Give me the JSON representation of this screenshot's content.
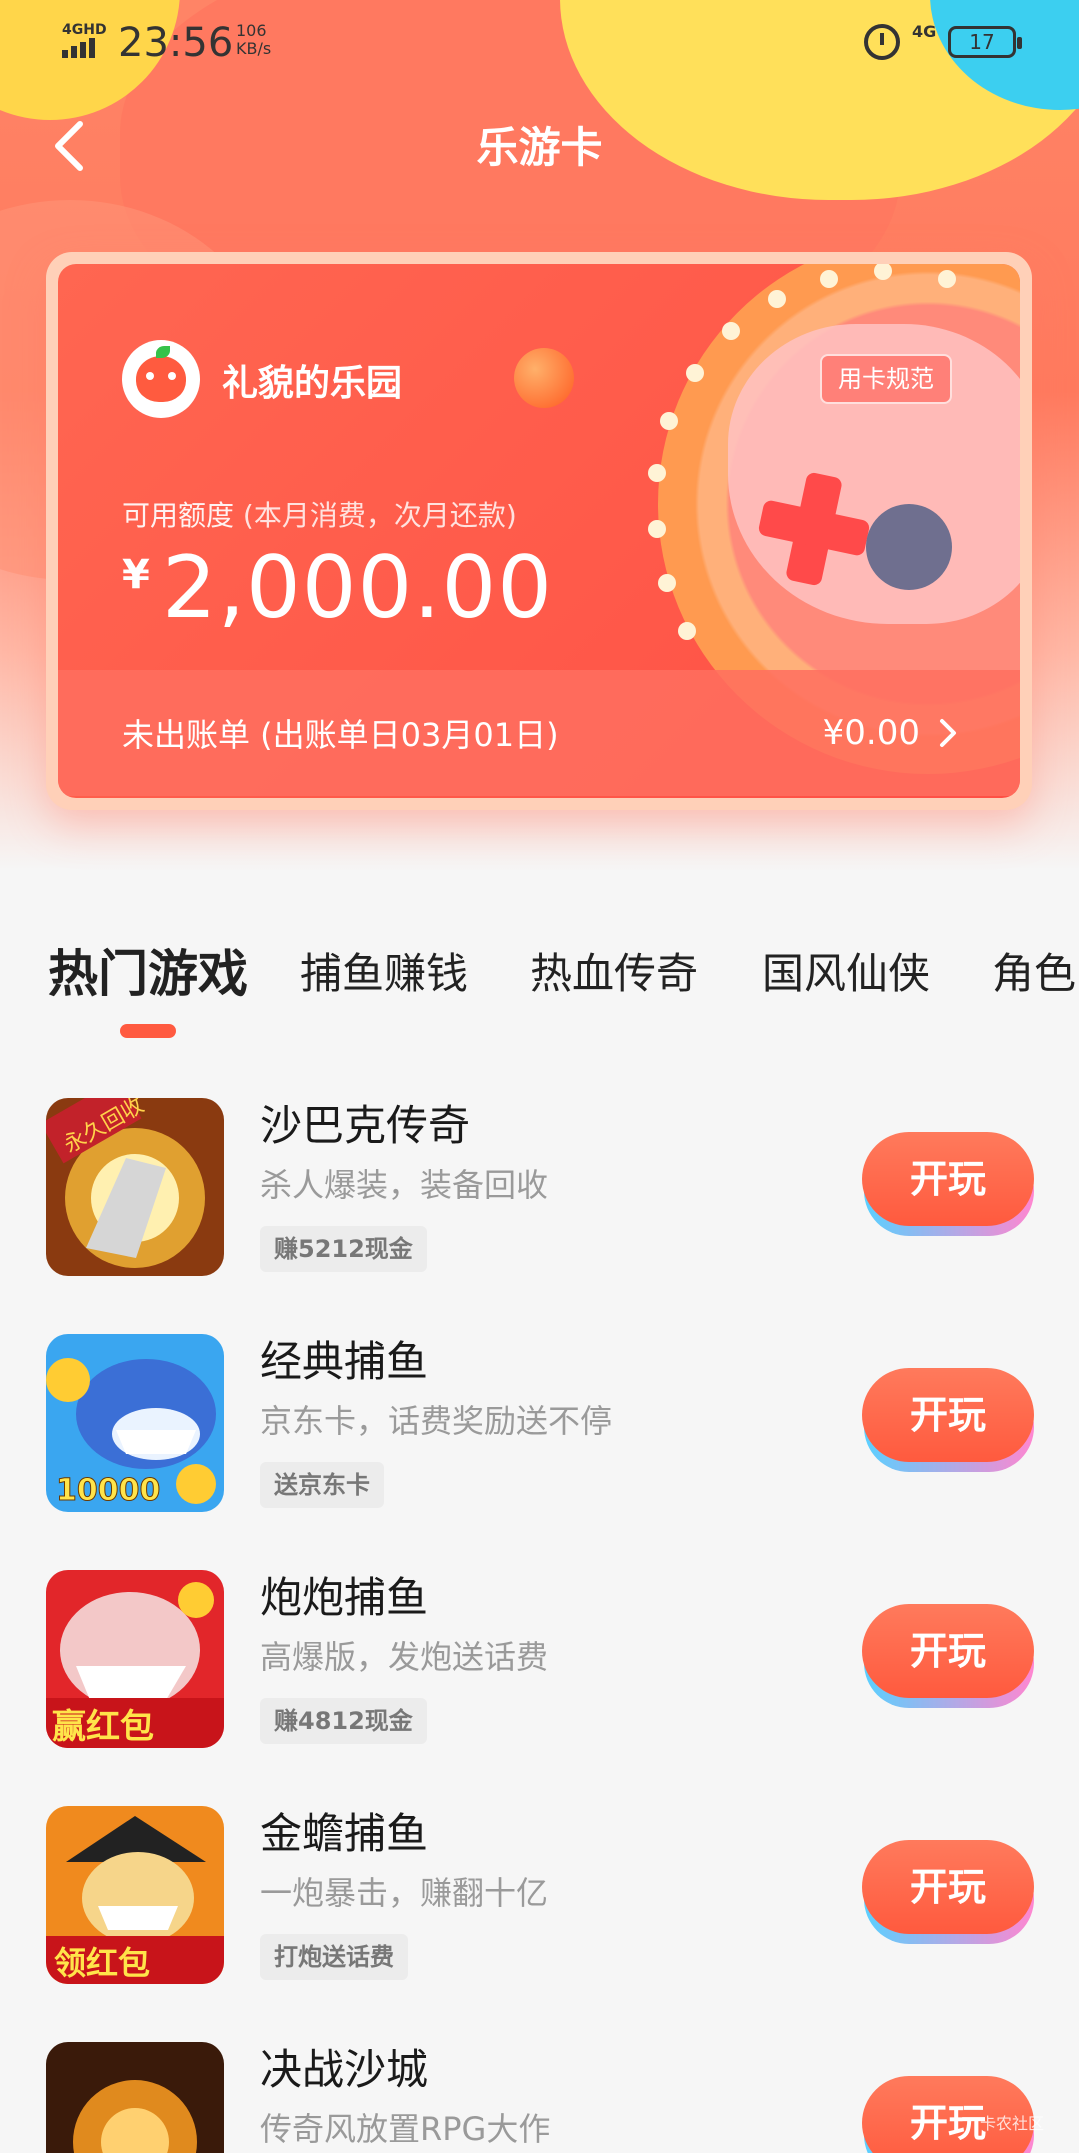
{
  "status_bar": {
    "network": "4GHD",
    "time": "23:56",
    "speed_value": "106",
    "speed_unit": "KB/s",
    "network_right": "4G",
    "battery": "17"
  },
  "nav": {
    "title": "乐游卡"
  },
  "card": {
    "brand_name": "礼貌的乐园",
    "rules_button": "用卡规范",
    "credit_label": "可用额度",
    "credit_note": "(本月消费，次月还款)",
    "currency": "¥",
    "credit_amount": "2,000.00",
    "bill_label": "未出账单 (出账单日03月01日)",
    "bill_amount": "¥0.00"
  },
  "tabs": [
    {
      "label": "热门游戏",
      "active": true
    },
    {
      "label": "捕鱼赚钱",
      "active": false
    },
    {
      "label": "热血传奇",
      "active": false
    },
    {
      "label": "国风仙侠",
      "active": false
    },
    {
      "label": "角色",
      "active": false
    }
  ],
  "games": [
    {
      "name": "沙巴克传奇",
      "desc": "杀人爆装，装备回收",
      "tag": "赚5212现金",
      "button": "开玩",
      "icon_text": "永久回收"
    },
    {
      "name": "经典捕鱼",
      "desc": "京东卡，话费奖励送不停",
      "tag": "送京东卡",
      "button": "开玩",
      "icon_text": "10000"
    },
    {
      "name": "炮炮捕鱼",
      "desc": "高爆版，发炮送话费",
      "tag": "赚4812现金",
      "button": "开玩",
      "icon_text": "赢红包"
    },
    {
      "name": "金蟾捕鱼",
      "desc": "一炮暴击，赚翻十亿",
      "tag": "打炮送话费",
      "button": "开玩",
      "icon_text": "领红包"
    },
    {
      "name": "决战沙城",
      "desc": "传奇风放置RPG大作",
      "tag": "",
      "button": "开玩",
      "icon_text": ""
    }
  ],
  "watermark": "卡农社区",
  "colors": {
    "accent": "#ff5a40",
    "card": "#ff5a4a",
    "tag_bg": "#ececec"
  }
}
